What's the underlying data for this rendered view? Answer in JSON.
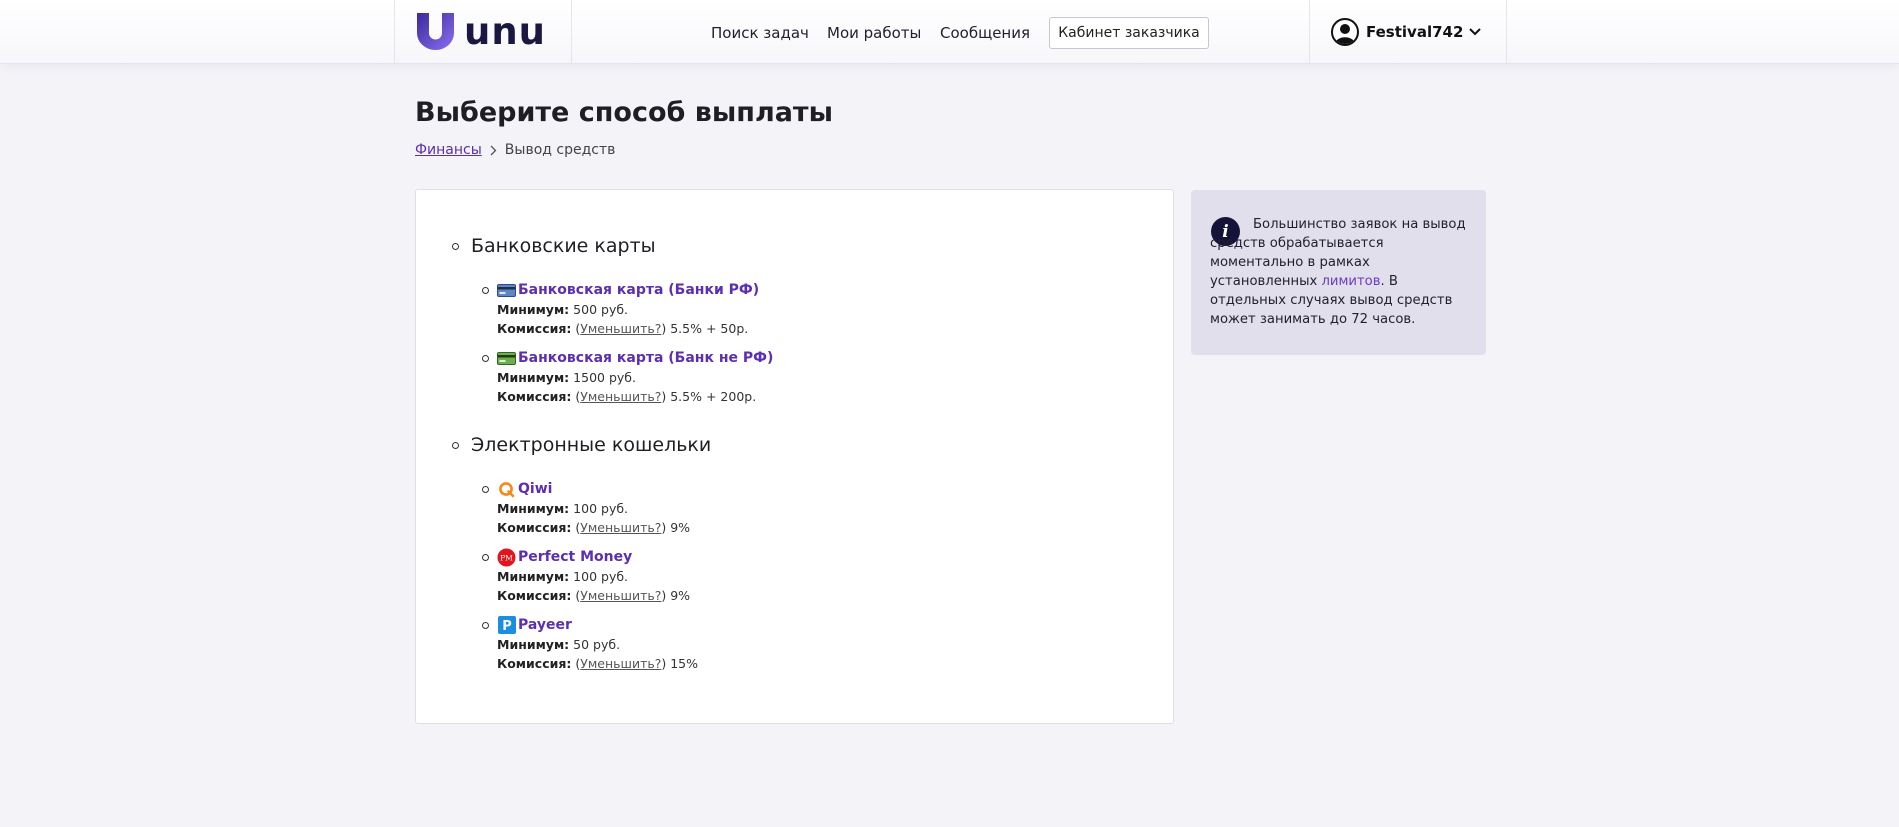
{
  "header": {
    "logo_text": "unu",
    "nav": [
      "Поиск задач",
      "Мои работы",
      "Сообщения"
    ],
    "client_cabinet": "Кабинет заказчика",
    "username": "Festival742"
  },
  "page": {
    "title": "Выберите способ выплаты",
    "breadcrumb": {
      "parent": "Финансы",
      "current": "Вывод средств"
    }
  },
  "labels": {
    "min": "Минимум:",
    "fee": "Комиссия:",
    "reduce": "Уменьшить?"
  },
  "sections": [
    {
      "title": "Банковские карты",
      "methods": [
        {
          "name": "Банковская карта (Банки РФ)",
          "icon": "bank-card-icon",
          "min": "500 руб.",
          "fee": "5.5% + 50р."
        },
        {
          "name": "Банковская карта (Банк не РФ)",
          "icon": "bank-card-green-icon",
          "min": "1500 руб.",
          "fee": "5.5% + 200р."
        }
      ]
    },
    {
      "title": "Электронные кошельки",
      "methods": [
        {
          "name": "Qiwi",
          "icon": "qiwi-icon",
          "min": "100 руб.",
          "fee": "9%"
        },
        {
          "name": "Perfect Money",
          "icon": "perfect-money-icon",
          "min": "100 руб.",
          "fee": "9%"
        },
        {
          "name": "Payeer",
          "icon": "payeer-icon",
          "min": "50 руб.",
          "fee": "15%"
        }
      ]
    }
  ],
  "info": {
    "text_before": "Большинство заявок на вывод средств обрабатывается моментально в рамках установленных ",
    "link": "лимитов",
    "text_after": ". В отдельных случаях вывод средств может занимать до 72 часов."
  },
  "colors": {
    "accent": "#5b2fb0",
    "background": "#f4f3f7",
    "info_bg": "#e1dfec"
  }
}
